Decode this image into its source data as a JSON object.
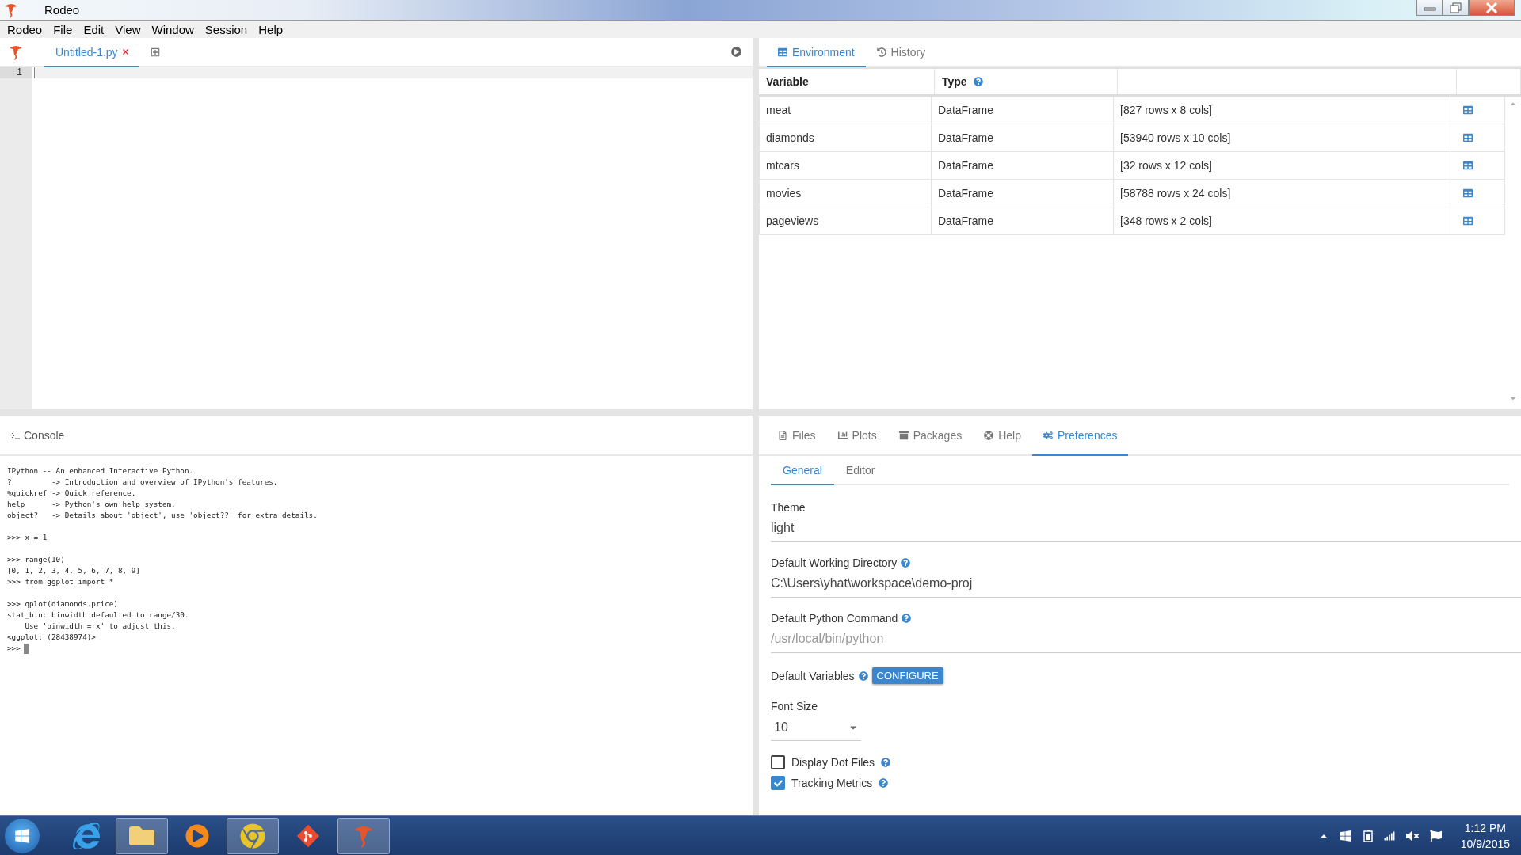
{
  "window": {
    "title": "Rodeo"
  },
  "menu": [
    "Rodeo",
    "File",
    "Edit",
    "View",
    "Window",
    "Session",
    "Help"
  ],
  "editor": {
    "tabs": [
      {
        "label": "Untitled-1.py",
        "selected": true
      }
    ],
    "line_numbers": [
      "1"
    ]
  },
  "environment": {
    "tabs": [
      {
        "label": "Environment",
        "selected": true
      },
      {
        "label": "History",
        "selected": false
      }
    ],
    "columns": [
      "Variable",
      "Type"
    ],
    "rows": [
      {
        "name": "meat",
        "type": "DataFrame",
        "info": "[827 rows x 8 cols]"
      },
      {
        "name": "diamonds",
        "type": "DataFrame",
        "info": "[53940 rows x 10 cols]"
      },
      {
        "name": "mtcars",
        "type": "DataFrame",
        "info": "[32 rows x 12 cols]"
      },
      {
        "name": "movies",
        "type": "DataFrame",
        "info": "[58788 rows x 24 cols]"
      },
      {
        "name": "pageviews",
        "type": "DataFrame",
        "info": "[348 rows x 2 cols]"
      }
    ]
  },
  "console": {
    "title": "Console",
    "blocks": [
      [
        "IPython -- An enhanced Interactive Python.",
        "?         -> Introduction and overview of IPython's features.",
        "%quickref -> Quick reference.",
        "help      -> Python's own help system.",
        "object?   -> Details about 'object', use 'object??' for extra details."
      ],
      [
        ">>> x = 1"
      ],
      [
        ">>> range(10)",
        "[0, 1, 2, 3, 4, 5, 6, 7, 8, 9]",
        ">>> from ggplot import *"
      ],
      [
        ">>> qplot(diamonds.price)",
        "stat_bin: binwidth defaulted to range/30.",
        "    Use 'binwidth = x' to adjust this.",
        "<ggplot: (28438974)>"
      ]
    ],
    "prompt": ">>>"
  },
  "panel": {
    "tabs": [
      {
        "label": "Files",
        "selected": false
      },
      {
        "label": "Plots",
        "selected": false
      },
      {
        "label": "Packages",
        "selected": false
      },
      {
        "label": "Help",
        "selected": false
      },
      {
        "label": "Preferences",
        "selected": true
      }
    ],
    "subtabs": [
      {
        "label": "General",
        "selected": true
      },
      {
        "label": "Editor",
        "selected": false
      }
    ],
    "fields": [
      {
        "kind": "text",
        "label": "Theme",
        "help": false,
        "value": "light"
      },
      {
        "kind": "text",
        "label": "Default Working Directory",
        "help": true,
        "value": "C:\\Users\\yhat\\workspace\\demo-proj"
      },
      {
        "kind": "text",
        "label": "Default Python Command",
        "help": true,
        "placeholder": "/usr/local/bin/python"
      },
      {
        "kind": "button",
        "label": "Default Variables",
        "help": true,
        "button": "CONFIGURE"
      },
      {
        "kind": "select",
        "label": "Font Size",
        "help": false,
        "value": "10"
      },
      {
        "kind": "checkbox",
        "label": "Display Dot Files",
        "help": true,
        "checked": false
      },
      {
        "kind": "checkbox",
        "label": "Tracking Metrics",
        "help": true,
        "checked": true
      }
    ]
  },
  "taskbar": {
    "time": "1:12 PM",
    "date": "10/9/2015"
  }
}
